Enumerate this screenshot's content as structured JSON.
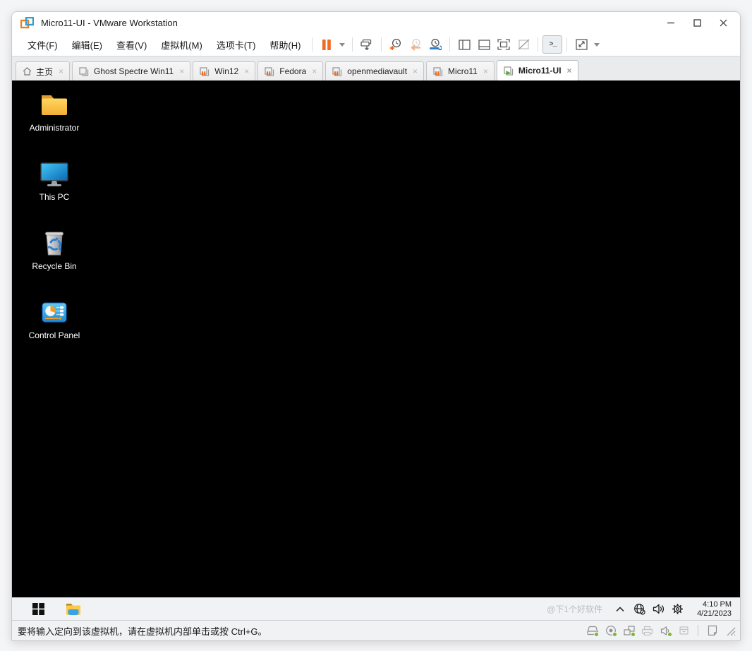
{
  "window": {
    "title": "Micro11-UI - VMware Workstation",
    "controls": [
      "minimize",
      "maximize",
      "close"
    ]
  },
  "menu": {
    "items": [
      "文件(F)",
      "编辑(E)",
      "查看(V)",
      "虚拟机(M)",
      "选项卡(T)",
      "帮助(H)"
    ]
  },
  "toolbar": {
    "console_glyph": ">_",
    "icons": [
      "suspend-vm",
      "suspend-dropdown",
      "send-ctrl-alt-del",
      "take-snapshot",
      "revert-snapshot",
      "snapshot-manager",
      "show-library-panel",
      "show-thumbnail-bar",
      "fullscreen-mode",
      "unity-mode",
      "console-view",
      "stretch-guest",
      "stretch-dropdown"
    ]
  },
  "ui": {
    "close_glyph": "×"
  },
  "tabs": [
    {
      "label": "主页",
      "icon": "home",
      "state": "normal"
    },
    {
      "label": "Ghost Spectre Win11",
      "icon": "vm-powered-off",
      "state": "normal"
    },
    {
      "label": "Win12",
      "icon": "vm-suspended",
      "state": "normal"
    },
    {
      "label": "Fedora",
      "icon": "vm-suspended",
      "state": "normal"
    },
    {
      "label": "openmediavault",
      "icon": "vm-suspended",
      "state": "normal"
    },
    {
      "label": "Micro11",
      "icon": "vm-suspended",
      "state": "normal"
    },
    {
      "label": "Micro11-UI",
      "icon": "vm-running",
      "state": "active"
    }
  ],
  "desktop": {
    "icons": [
      {
        "label": "Administrator",
        "icon": "folder"
      },
      {
        "label": "This PC",
        "icon": "monitor"
      },
      {
        "label": "Recycle Bin",
        "icon": "recycle-bin"
      },
      {
        "label": "Control Panel",
        "icon": "control-panel"
      }
    ]
  },
  "taskbar": {
    "pinned": [
      "start",
      "file-explorer"
    ],
    "watermark": "@下1个好软件",
    "tray_icons": [
      "tray-expand",
      "network-offline",
      "volume",
      "settings"
    ],
    "time": "4:10 PM",
    "date": "4/21/2023"
  },
  "statusbar": {
    "message": "要将输入定向到该虚拟机，请在虚拟机内部单击或按 Ctrl+G。",
    "device_icons": [
      "hard-disk",
      "cd-dvd",
      "network-adapter",
      "printer",
      "sound",
      "usb-device",
      "message-log"
    ],
    "status_ok_color": "#7ab82c",
    "accent_orange": "#ee6b21",
    "accent_blue": "#2f7fd0",
    "accent_green": "#4caf2f"
  }
}
